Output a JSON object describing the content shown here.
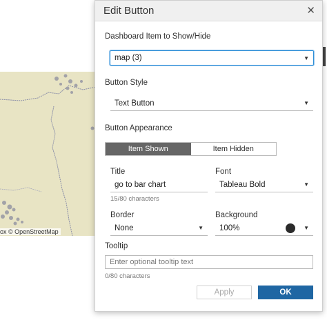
{
  "map": {
    "attribution": "ox © OpenStreetMap"
  },
  "dialog": {
    "title": "Edit Button",
    "close_symbol": "✕",
    "dashboard_item": {
      "label": "Dashboard Item to Show/Hide",
      "value": "map (3)"
    },
    "button_style": {
      "label": "Button Style",
      "value": "Text Button"
    },
    "appearance": {
      "label": "Button Appearance",
      "tabs": [
        {
          "label": "Item Shown",
          "active": true
        },
        {
          "label": "Item Hidden",
          "active": false
        }
      ]
    },
    "title_field": {
      "label": "Title",
      "value": "go to bar chart",
      "hint": "15/80 characters"
    },
    "font_field": {
      "label": "Font",
      "value": "Tableau Bold"
    },
    "border_field": {
      "label": "Border",
      "value": "None"
    },
    "background_field": {
      "label": "Background",
      "value": "100%",
      "color": "#2b2b2b"
    },
    "tooltip": {
      "label": "Tooltip",
      "placeholder": "Enter optional tooltip text",
      "hint": "0/80 characters"
    },
    "buttons": {
      "apply": "Apply",
      "ok": "OK"
    }
  },
  "colors": {
    "accent": "#1f66a3",
    "focus": "#2b8dd6",
    "map_land": "#e8e4c4"
  }
}
